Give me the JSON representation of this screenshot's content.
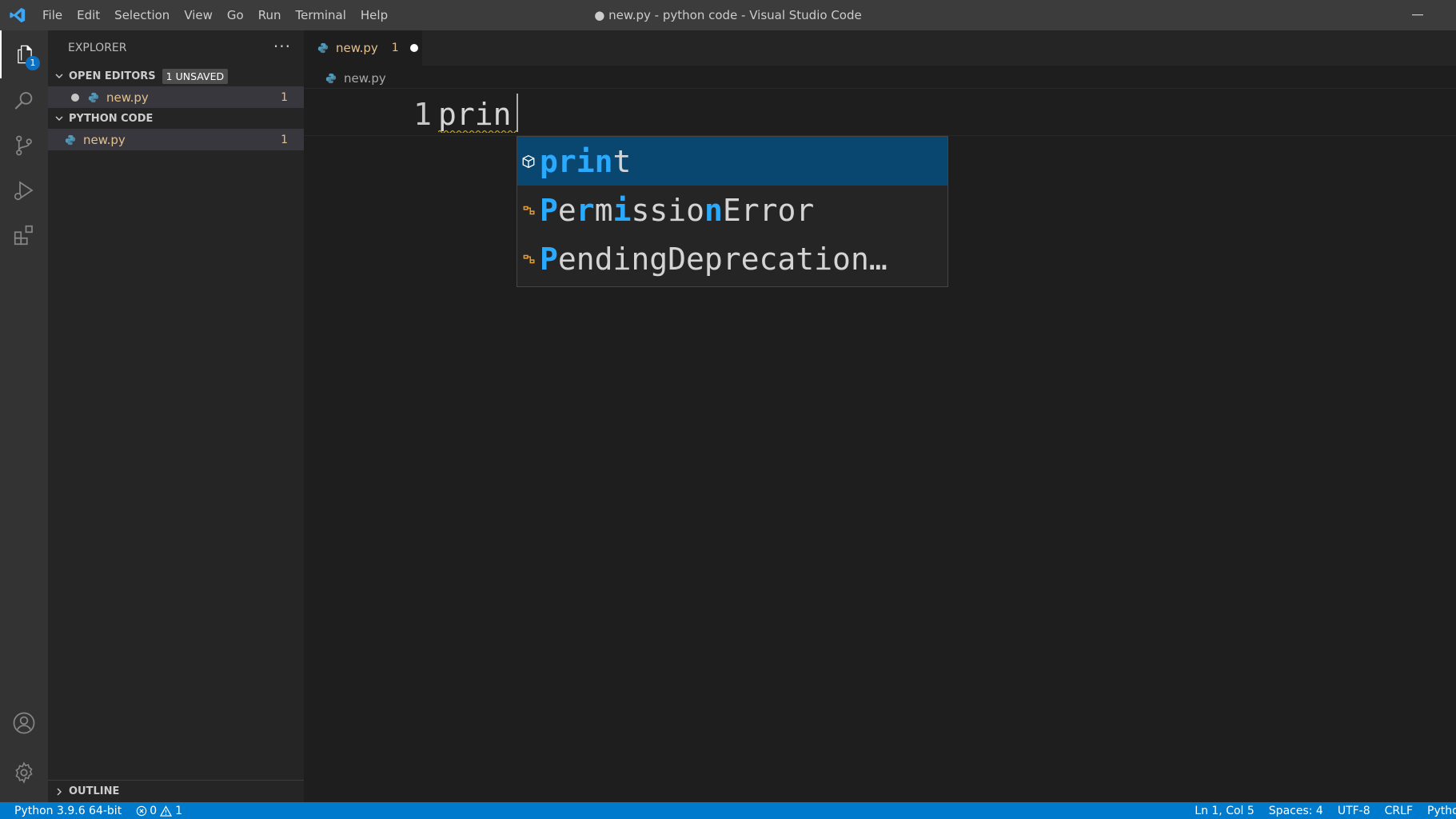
{
  "window": {
    "title": "● new.py - python code - Visual Studio Code"
  },
  "menu": [
    "File",
    "Edit",
    "Selection",
    "View",
    "Go",
    "Run",
    "Terminal",
    "Help"
  ],
  "activity_bar": {
    "explorer_badge": "1"
  },
  "sidebar": {
    "title": "EXPLORER",
    "more_label": "···",
    "open_editors": {
      "label": "OPEN EDITORS",
      "badge": "1 UNSAVED",
      "file": "new.py",
      "problems": "1"
    },
    "folder": {
      "label": "PYTHON CODE",
      "file": "new.py",
      "problems": "1"
    },
    "outline_label": "OUTLINE"
  },
  "editor": {
    "tab": {
      "name": "new.py",
      "problems": "1"
    },
    "breadcrumb": "new.py",
    "line_number": "1",
    "code": "prin"
  },
  "suggestions": [
    {
      "match": "print",
      "rest": "",
      "kind": "method-icon",
      "selected": true,
      "display_plain": "t",
      "display_hl": "prin"
    },
    {
      "parts": [
        [
          "P",
          true
        ],
        [
          "e",
          false
        ],
        [
          "r",
          true
        ],
        [
          "m",
          false
        ],
        [
          "i",
          true
        ],
        [
          "ssio",
          false
        ],
        [
          "n",
          true
        ],
        [
          "Error",
          false
        ]
      ],
      "kind": "class-icon"
    },
    {
      "parts": [
        [
          "P",
          true
        ],
        [
          "endingDeprecation…",
          false
        ]
      ],
      "kind": "class-icon"
    }
  ],
  "status": {
    "interpreter": "Python 3.9.6 64-bit",
    "errors": "0",
    "warnings": "1",
    "position": "Ln 1, Col 5",
    "spaces": "Spaces: 4",
    "encoding": "UTF-8",
    "eol": "CRLF",
    "language": "Python"
  },
  "colors": {
    "accent": "#007acc",
    "modified": "#e2c08d",
    "suggest_selected": "#094771",
    "match_highlight": "#2aaaff"
  }
}
